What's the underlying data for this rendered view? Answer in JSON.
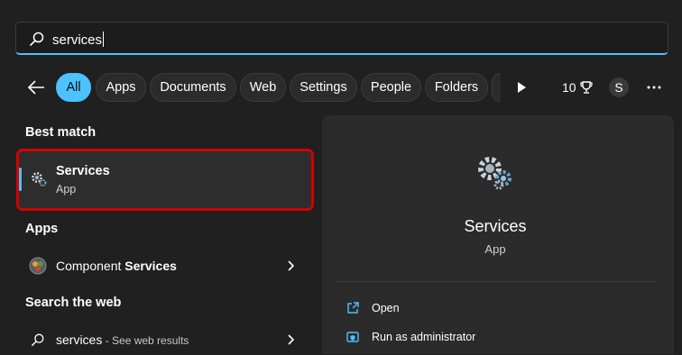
{
  "search": {
    "query": "services"
  },
  "filters": {
    "tabs": [
      {
        "label": "All"
      },
      {
        "label": "Apps"
      },
      {
        "label": "Documents"
      },
      {
        "label": "Web"
      },
      {
        "label": "Settings"
      },
      {
        "label": "People"
      },
      {
        "label": "Folders"
      }
    ],
    "points": "10",
    "avatar_initial": "S"
  },
  "left": {
    "best_match_heading": "Best match",
    "best_match": {
      "title": "Services",
      "subtitle": "App"
    },
    "apps_heading": "Apps",
    "apps": [
      {
        "label_prefix": "Component ",
        "label_bold": "Services"
      }
    ],
    "web_heading": "Search the web",
    "web": [
      {
        "query": "services",
        "suffix": " - See web results"
      }
    ]
  },
  "detail": {
    "title": "Services",
    "subtitle": "App",
    "actions": [
      {
        "label": "Open",
        "icon": "open-external-icon"
      },
      {
        "label": "Run as administrator",
        "icon": "admin-shield-icon"
      }
    ]
  },
  "colors": {
    "accent": "#4cc2ff",
    "highlight_border": "#d40000",
    "background": "#202020"
  }
}
